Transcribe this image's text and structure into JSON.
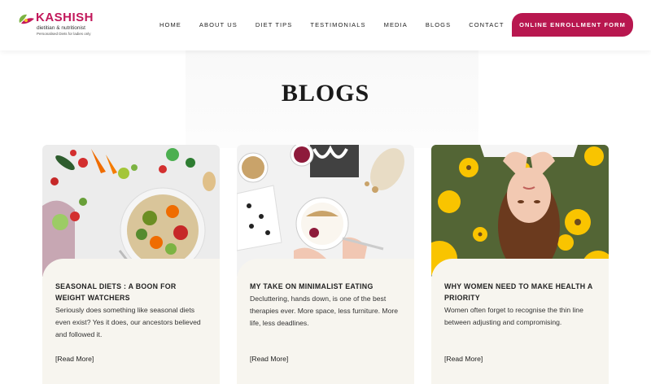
{
  "brand": {
    "name": "KASHISH",
    "subtitle": "dietitian & nutritionist",
    "tagline": "Personalised Diets for ladies only",
    "color": "#c2185b"
  },
  "nav": {
    "items": [
      "HOME",
      "ABOUT US",
      "DIET TIPS",
      "TESTIMONIALS",
      "MEDIA",
      "BLOGS",
      "CONTACT"
    ]
  },
  "cta": {
    "label": "ONLINE ENROLLMENT FORM",
    "color": "#b8174f"
  },
  "page": {
    "title": "BLOGS"
  },
  "posts": [
    {
      "title": "SEASONAL DIETS : A BOON FOR WEIGHT WATCHERS",
      "excerpt": "Seriously does something like seasonal diets even exist? Yes it does, our ancestors believed and followed it.",
      "read_more": "[Read More]",
      "image_icon": "vegetable-bowl-image"
    },
    {
      "title": "MY TAKE ON MINIMALIST EATING",
      "excerpt": "Decluttering, hands down, is one of the best therapies ever. More space, less furniture. More life, less deadlines.",
      "read_more": "[Read More]",
      "image_icon": "granola-bowl-image"
    },
    {
      "title": "WHY WOMEN NEED TO MAKE HEALTH A PRIORITY",
      "excerpt": "Women often forget to recognise the thin line between adjusting and compromising.",
      "read_more": "[Read More]",
      "image_icon": "woman-flowers-image"
    }
  ],
  "colors": {
    "card_bg": "#f7f5ef",
    "accent": "#b8174f"
  }
}
